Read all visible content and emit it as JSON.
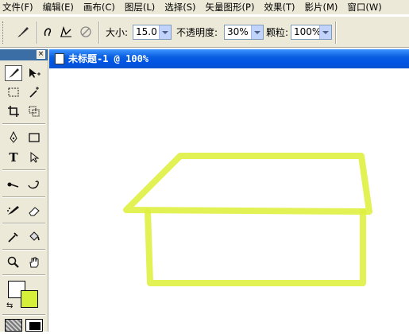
{
  "menu": [
    "文件(F)",
    "编辑(E)",
    "画布(C)",
    "图层(L)",
    "选择(S)",
    "矢量图形(P)",
    "效果(T)",
    "影片(M)",
    "窗口(W)"
  ],
  "options": {
    "size_label": "大小:",
    "size_value": "15.0",
    "opacity_label": "不透明度:",
    "opacity_value": "30%",
    "grain_label": "颗粒:",
    "grain_value": "100%"
  },
  "document": {
    "title": "未标题-1 @ 100%"
  },
  "colors": {
    "stroke_color": "#ffffff",
    "fill_color": "#d6f03a",
    "sketch_color": "#dff041"
  },
  "tools": [
    "brush-icon",
    "subselect-icon",
    "marquee-icon",
    "magic-wand-icon",
    "crop-icon",
    "transform-icon",
    "pen-icon",
    "rectangle-icon",
    "text-icon",
    "pointer-icon",
    "lasso-icon",
    "freeform-icon",
    "paint-icon",
    "eraser-icon",
    "eyedropper-icon",
    "bucket-icon",
    "zoom-icon",
    "hand-icon"
  ]
}
